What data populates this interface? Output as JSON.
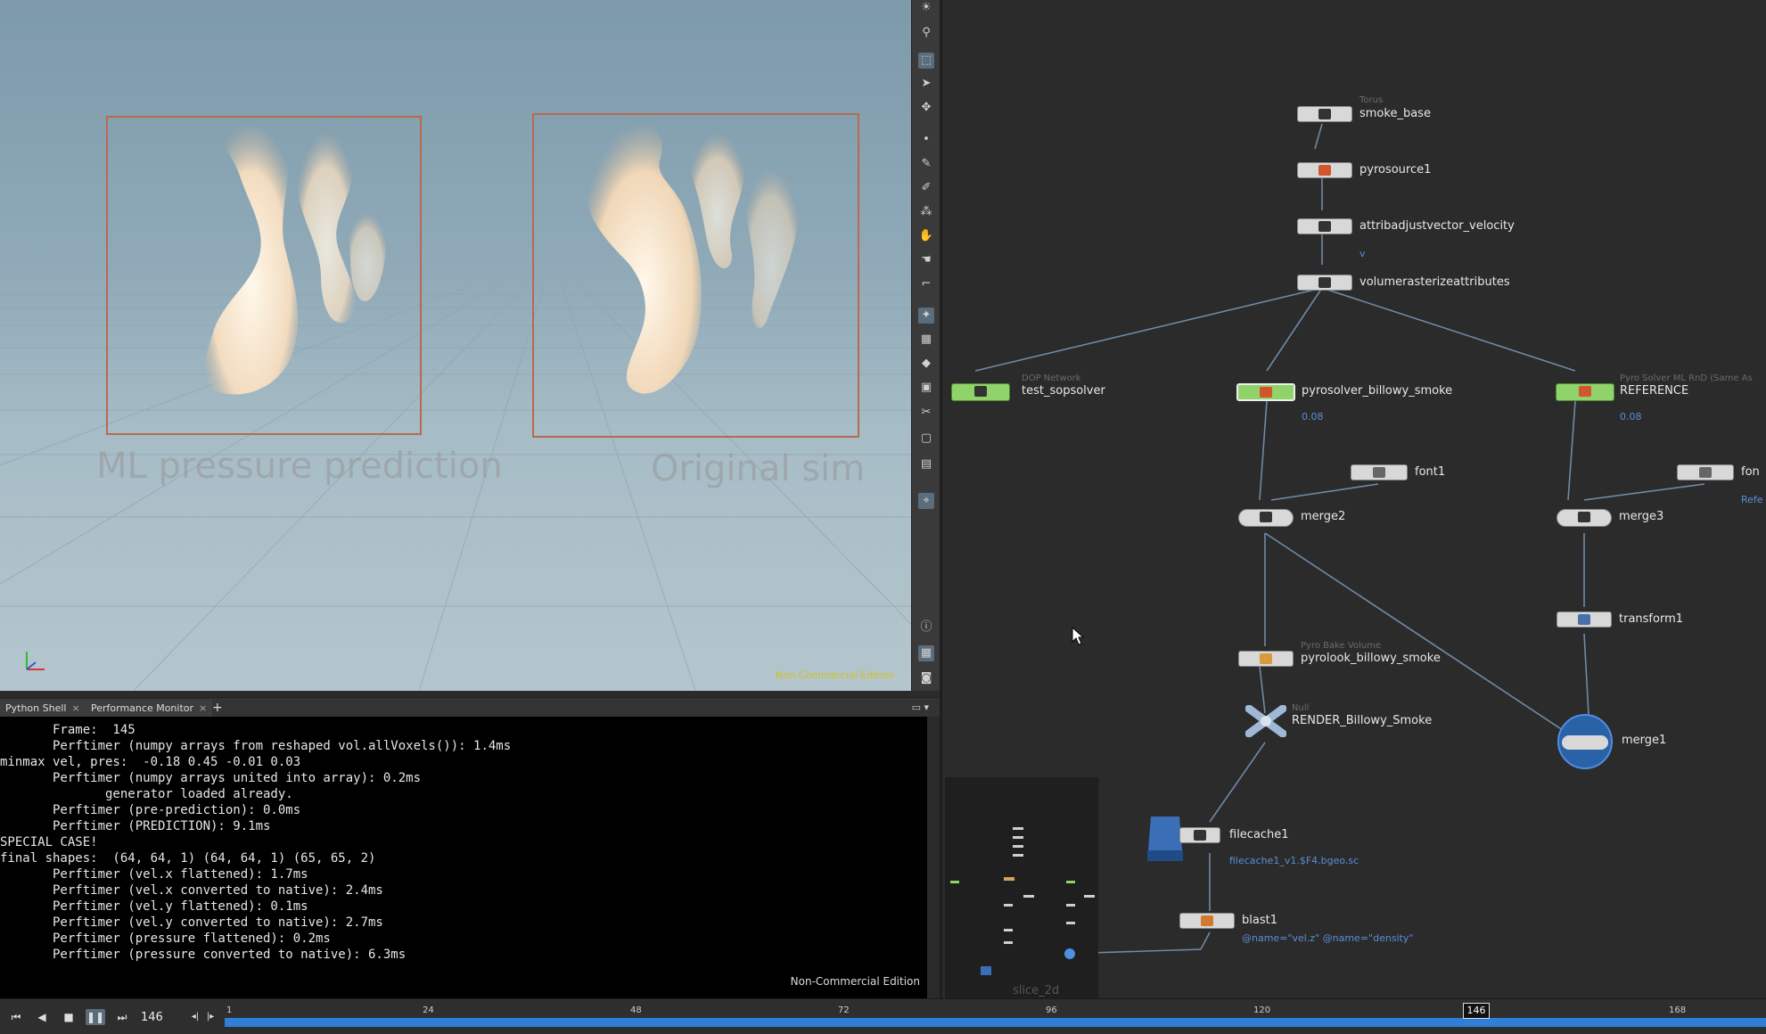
{
  "viewport": {
    "left_label": "ML pressure prediction",
    "right_label": "Original sim",
    "watermark": "Non-Commercial Edition"
  },
  "shell": {
    "tabs": [
      {
        "label": "Python Shell"
      },
      {
        "label": "Performance Monitor"
      }
    ],
    "add_tab": "+",
    "lines": [
      "       Frame:  145",
      "       Perftimer (numpy arrays from reshaped vol.allVoxels()): 1.4ms",
      "minmax vel, pres:  -0.18 0.45 -0.01 0.03",
      "       Perftimer (numpy arrays united into array): 0.2ms",
      "              generator loaded already.",
      "       Perftimer (pre-prediction): 0.0ms",
      "       Perftimer (PREDICTION): 9.1ms",
      "SPECIAL CASE!",
      "final shapes:  (64, 64, 1) (64, 64, 1) (65, 65, 2)",
      "       Perftimer (vel.x flattened): 1.7ms",
      "       Perftimer (vel.x converted to native): 2.4ms",
      "       Perftimer (vel.y flattened): 0.1ms",
      "       Perftimer (vel.y converted to native): 2.7ms",
      "       Perftimer (pressure flattened): 0.2ms",
      "       Perftimer (pressure converted to native): 6.3ms"
    ],
    "watermark": "Non-Commercial Edition"
  },
  "network": {
    "nodes": {
      "smoke_base": {
        "type": "Torus",
        "name": "smoke_base"
      },
      "pyrosource1": {
        "name": "pyrosource1"
      },
      "attribadjust": {
        "name": "attribadjustvector_velocity",
        "sub": "v"
      },
      "volraster": {
        "name": "volumerasterizeattributes"
      },
      "test_sopsolver": {
        "type": "DOP Network",
        "name": "test_sopsolver"
      },
      "pyrosolver": {
        "name": "pyrosolver_billowy_smoke",
        "sub": "0.08"
      },
      "reference": {
        "type": "Pyro Solver ML RnD (Same As",
        "name": "REFERENCE",
        "sub": "0.08"
      },
      "font1": {
        "name": "font1"
      },
      "font2": {
        "name": "fon",
        "sub": "Refe"
      },
      "merge2": {
        "name": "merge2"
      },
      "merge3": {
        "name": "merge3"
      },
      "transform1": {
        "name": "transform1"
      },
      "pyrolook": {
        "type": "Pyro Bake Volume",
        "name": "pyrolook_billowy_smoke"
      },
      "render": {
        "type": "Null",
        "name": "RENDER_Billowy_Smoke"
      },
      "merge1": {
        "name": "merge1"
      },
      "filecache1": {
        "name": "filecache1",
        "sub": "filecache1_v1.$F4.bgeo.sc"
      },
      "blast1": {
        "name": "blast1",
        "sub": "@name=\"vel.z\" @name=\"density\""
      },
      "slice": {
        "name": "slice_2d"
      }
    }
  },
  "timeline": {
    "current_frame": "146",
    "ticks": [
      "1",
      "24",
      "48",
      "72",
      "96",
      "120",
      "146",
      "168"
    ],
    "marker": "146"
  },
  "colors": {
    "selected_blue": "#2f7fd8",
    "node_green": "#8fd36a",
    "link": "#6f8aa6"
  }
}
